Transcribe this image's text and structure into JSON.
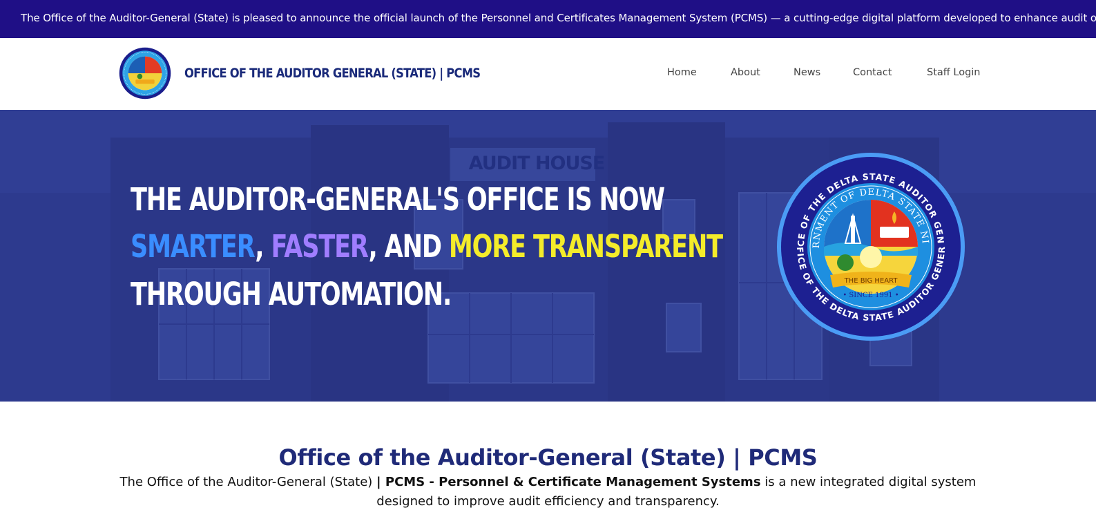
{
  "ticker": {
    "text": "The Office of the Auditor-General (State) is pleased to announce the official launch of the Personnel and Certificates Management System (PCMS) — a cutting-edge digital platform developed to enhance audit operations a"
  },
  "header": {
    "site_title": "OFFICE OF THE AUDITOR GENERAL (STATE) | PCMS",
    "nav": [
      {
        "label": "Home"
      },
      {
        "label": "About"
      },
      {
        "label": "News"
      },
      {
        "label": "Contact"
      },
      {
        "label": "Staff Login"
      }
    ]
  },
  "hero": {
    "line1": "THE AUDITOR-GENERAL'S OFFICE IS NOW",
    "line2": {
      "smarter": "SMARTER",
      "comma1": ",",
      "faster": "FASTER",
      "and": ", AND",
      "transparent": "MORE TRANSPARENT"
    },
    "line3": "THROUGH AUTOMATION.",
    "building_sign": "AUDIT HOUSE",
    "seal": {
      "outer_text": "OFFICE OF THE DELTA STATE AUDITOR GENERAL",
      "inner_text": "GOVERNMENT OF DELTA STATE NIGERIA",
      "ribbon": "THE BIG HEART",
      "since": "• SINCE 1991 •"
    }
  },
  "intro": {
    "title": "Office of the Auditor-General (State) | PCMS",
    "text_part1": "The Office of the Auditor-General (State) ",
    "text_bold": "| PCMS - Personnel & Certificate Management Systems",
    "text_part2": " is a new integrated digital system designed to improve audit efficiency and transparency."
  },
  "colors": {
    "ticker_bg": "#1f0f86",
    "title_navy": "#1a2a7a",
    "hero_overlay": "#2d3a8c",
    "accent_blue": "#3a8dff",
    "accent_purple": "#a07dff",
    "accent_yellow": "#f4ec2a"
  }
}
